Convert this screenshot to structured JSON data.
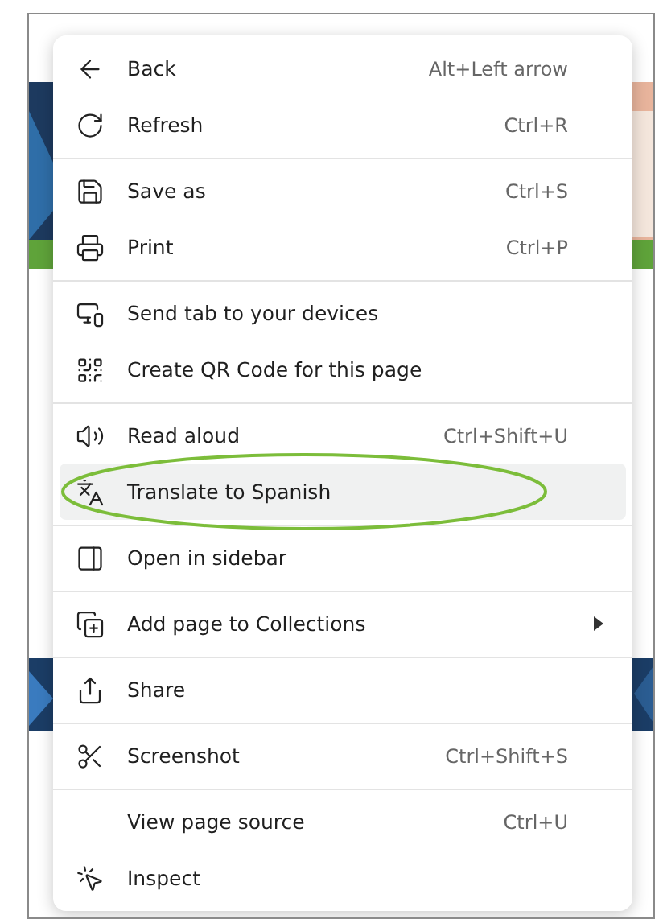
{
  "menu": {
    "groups": [
      {
        "items": [
          {
            "label": "Back",
            "shortcut": "Alt+Left arrow",
            "selected": false,
            "submenu": false,
            "circled": false
          },
          {
            "label": "Refresh",
            "shortcut": "Ctrl+R",
            "selected": false,
            "submenu": false,
            "circled": false
          }
        ]
      },
      {
        "items": [
          {
            "label": "Save as",
            "shortcut": "Ctrl+S",
            "selected": false,
            "submenu": false,
            "circled": false
          },
          {
            "label": "Print",
            "shortcut": "Ctrl+P",
            "selected": false,
            "submenu": false,
            "circled": false
          }
        ]
      },
      {
        "items": [
          {
            "label": "Send tab to your devices",
            "selected": false,
            "submenu": false,
            "circled": false
          },
          {
            "label": "Create QR Code for this page",
            "selected": false,
            "submenu": false,
            "circled": false
          }
        ]
      },
      {
        "items": [
          {
            "label": "Read aloud",
            "shortcut": "Ctrl+Shift+U",
            "selected": false,
            "submenu": false,
            "circled": false
          },
          {
            "label": "Translate to Spanish",
            "selected": true,
            "submenu": false,
            "circled": true
          }
        ]
      },
      {
        "items": [
          {
            "label": "Open in sidebar",
            "selected": false,
            "submenu": false,
            "circled": false
          }
        ]
      },
      {
        "items": [
          {
            "label": "Add page to Collections",
            "selected": false,
            "submenu": true,
            "circled": false
          }
        ]
      },
      {
        "items": [
          {
            "label": "Share",
            "selected": false,
            "submenu": false,
            "circled": false
          }
        ]
      },
      {
        "items": [
          {
            "label": "Screenshot",
            "shortcut": "Ctrl+Shift+S",
            "selected": false,
            "submenu": false,
            "circled": false
          }
        ]
      },
      {
        "items": [
          {
            "label": "View page source",
            "shortcut": "Ctrl+U",
            "selected": false,
            "submenu": false,
            "circled": false
          },
          {
            "label": "Inspect",
            "selected": false,
            "submenu": false,
            "circled": false
          }
        ]
      }
    ]
  }
}
